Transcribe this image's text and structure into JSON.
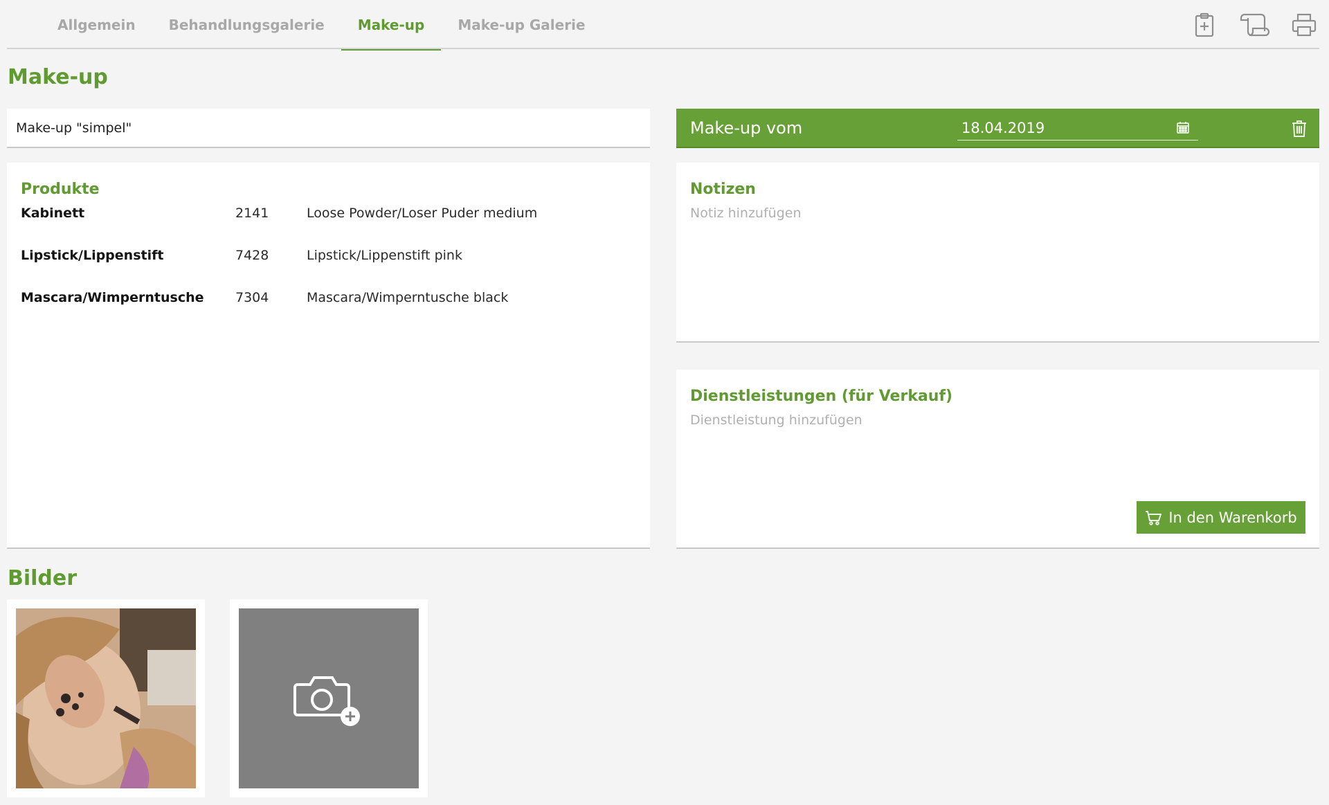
{
  "tabs": [
    {
      "label": "Allgemein",
      "active": false
    },
    {
      "label": "Behandlungsgalerie",
      "active": false
    },
    {
      "label": "Make-up",
      "active": true
    },
    {
      "label": "Make-up Galerie",
      "active": false
    }
  ],
  "toolbar_icons": [
    "clipboard-plus-icon",
    "scroll-icon",
    "printer-icon"
  ],
  "page_title": "Make-up",
  "makeup_name": "Make-up \"simpel\"",
  "date_bar": {
    "label": "Make-up vom",
    "date": "18.04.2019"
  },
  "products": {
    "title": "Produkte",
    "rows": [
      {
        "category": "Kabinett",
        "number": "2141",
        "name": "Loose Powder/Loser Puder medium"
      },
      {
        "category": "Lipstick/Lippenstift",
        "number": "7428",
        "name": "Lipstick/Lippenstift pink"
      },
      {
        "category": "Mascara/Wimperntusche",
        "number": "7304",
        "name": "Mascara/Wimperntusche black"
      }
    ]
  },
  "notes": {
    "title": "Notizen",
    "placeholder": "Notiz hinzufügen"
  },
  "services": {
    "title": "Dienstleistungen (für Verkauf)",
    "placeholder": "Dienstleistung hinzufügen",
    "cart_button": "In den Warenkorb"
  },
  "images": {
    "title": "Bilder"
  },
  "colors": {
    "accent": "#5f9b31",
    "bar": "#67a036",
    "background": "#f4f4f4",
    "placeholder_tile": "#808080"
  }
}
